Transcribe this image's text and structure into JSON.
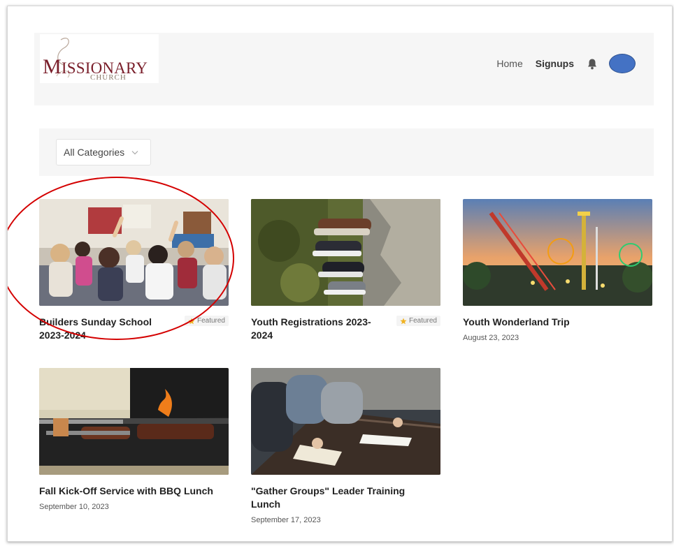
{
  "header": {
    "logo": {
      "text_main": "ISSIONARY",
      "text_initial": "M",
      "text_sub": "CHURCH"
    },
    "nav": [
      {
        "label": "Home",
        "active": false
      },
      {
        "label": "Signups",
        "active": true
      }
    ],
    "notification_icon": "bell-icon",
    "avatar_color": "#4472c4"
  },
  "filter": {
    "selected": "All Categories",
    "icon": "chevron-down-icon"
  },
  "signups": [
    {
      "title": "Builders Sunday School 2023-2024",
      "date": "",
      "featured": true,
      "badge": "Featured"
    },
    {
      "title": "Youth Registrations 2023-2024",
      "date": "",
      "featured": true,
      "badge": "Featured"
    },
    {
      "title": "Youth Wonderland Trip",
      "date": "August 23, 2023",
      "featured": false,
      "badge": ""
    },
    {
      "title": "Fall Kick-Off Service with BBQ Lunch",
      "date": "September 10, 2023",
      "featured": false,
      "badge": ""
    },
    {
      "title": "\"Gather Groups\" Leader Training Lunch",
      "date": "September 17, 2023",
      "featured": false,
      "badge": ""
    }
  ],
  "colors": {
    "logo_red": "#7a1f2b",
    "featured_star": "#f0b323",
    "annotation_red": "#d40000"
  }
}
